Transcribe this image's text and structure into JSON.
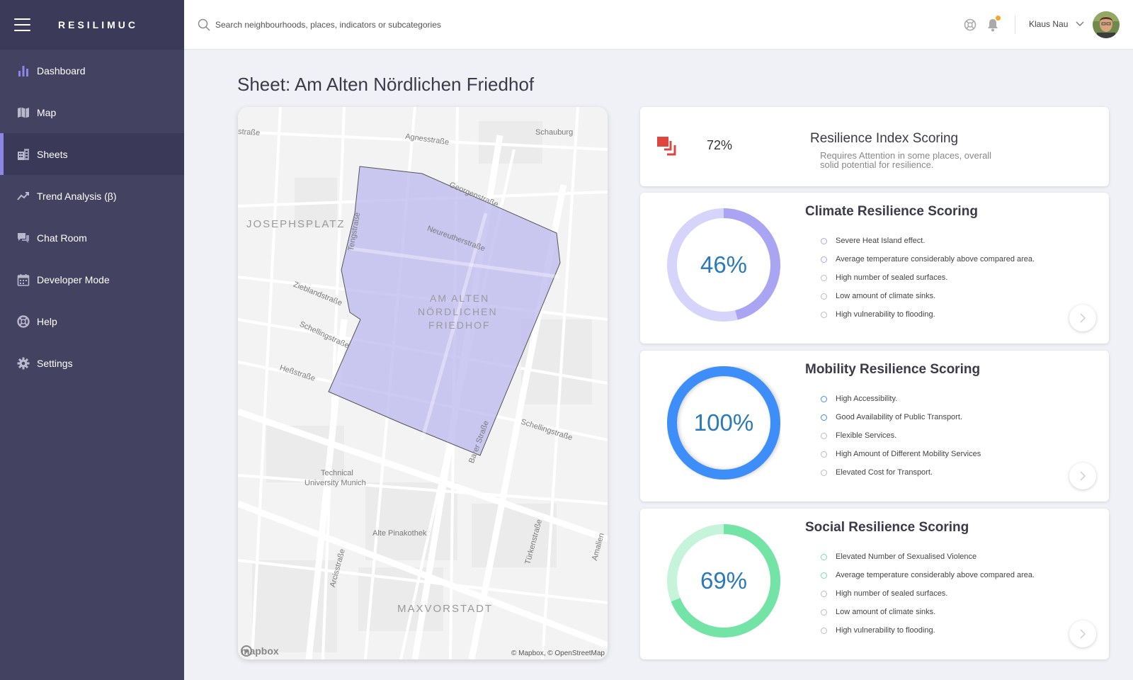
{
  "app": {
    "brand": "RESILIMUC"
  },
  "sidebar": {
    "items": [
      {
        "label": "Dashboard",
        "icon": "bar-chart-icon"
      },
      {
        "label": "Map",
        "icon": "map-icon"
      },
      {
        "label": "Sheets",
        "icon": "building-icon",
        "active": true
      },
      {
        "label": "Trend Analysis (β)",
        "icon": "trend-icon"
      },
      {
        "label": "Chat Room",
        "icon": "chat-icon"
      },
      {
        "label": "Developer Mode",
        "icon": "calendar-icon"
      },
      {
        "label": "Help",
        "icon": "lifebuoy-icon"
      },
      {
        "label": "Settings",
        "icon": "gear-icon"
      }
    ]
  },
  "topbar": {
    "search_placeholder": "Search neighbourhoods, places, indicators or subcategories",
    "user_name": "Klaus Nau"
  },
  "page": {
    "title": "Sheet: Am Alten Nördlichen Friedhof"
  },
  "map": {
    "area_label": [
      "AM ALTEN",
      "NÖRDLICHEN",
      "FRIEDHOF"
    ],
    "districts": {
      "josephsplatz": "JOSEPHSPLATZ",
      "maxvorstadt": "MAXVORSTADT"
    },
    "streets": {
      "strasse_edge": "straße",
      "agnes": "Agnesstraße",
      "schauburg": "Schauburg",
      "georgen": "Georgenstraße",
      "tengstr": "Tengstraße",
      "neureuther": "Neureutherstraße",
      "zieblands": "Zieblandstraße",
      "schelling_w": "Schellingstraße",
      "hess": "Heßstraße",
      "schelling_e": "Schellingstraße",
      "barer": "Barer Straße",
      "tum": [
        "Technical",
        "University Munich"
      ],
      "pinakothek": "Alte Pinakothek",
      "tuerken": "Türkenstraße",
      "arcis": "Arcisstraße",
      "amalien": "Amalien"
    },
    "attribution": "© Mapbox, © OpenStreetMap",
    "logo": "mapbox",
    "polygon_color": "#b9b6ee"
  },
  "index": {
    "value": "72%",
    "title": "Resilience Index Scoring",
    "description": "Requires Attention in some places, overall solid potential for resilience.",
    "icon": "layers-alert-icon",
    "color": "#e0443f"
  },
  "scores": [
    {
      "id": "climate",
      "title": "Climate Resilience Scoring",
      "value": 46,
      "label": "46%",
      "color": "#a9a5f3",
      "track": "#d6d4fb",
      "bullets": [
        {
          "text": "Severe Heat Island effect.",
          "highlight": true
        },
        {
          "text": "Average temperature considerably above compared area.",
          "highlight": true
        },
        {
          "text": "High number of sealed surfaces.",
          "highlight": false
        },
        {
          "text": "Low amount of climate sinks.",
          "highlight": false
        },
        {
          "text": "High vulnerability to flooding.",
          "highlight": false
        }
      ]
    },
    {
      "id": "mobility",
      "title": "Mobility Resilience Scoring",
      "value": 100,
      "label": "100%",
      "color": "#3d8ef8",
      "track": "#cfe2fd",
      "bullets": [
        {
          "text": "High Accessibility.",
          "highlight": true
        },
        {
          "text": "Good Availability of Public Transport.",
          "highlight": true
        },
        {
          "text": "Flexible Services.",
          "highlight": false
        },
        {
          "text": "High Amount of Different Mobility Services",
          "highlight": false
        },
        {
          "text": "Elevated Cost for Transport.",
          "highlight": false
        }
      ]
    },
    {
      "id": "social",
      "title": "Social Resilience Scoring",
      "value": 69,
      "label": "69%",
      "color": "#73e3a6",
      "track": "#c6f4da",
      "bullets": [
        {
          "text": "Elevated Number of Sexualised Violence",
          "highlight": true
        },
        {
          "text": "Average temperature considerably above compared area.",
          "highlight": true
        },
        {
          "text": "High number of sealed surfaces.",
          "highlight": false
        },
        {
          "text": "Low amount of climate sinks.",
          "highlight": false
        },
        {
          "text": "High vulnerability to flooding.",
          "highlight": false
        }
      ]
    }
  ]
}
